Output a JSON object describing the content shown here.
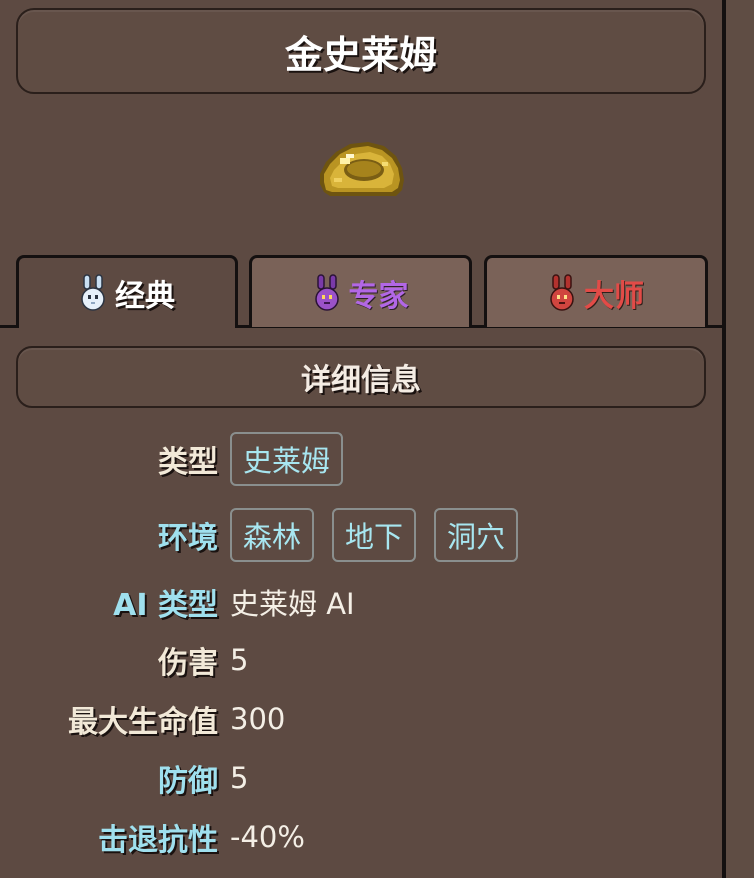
{
  "title": "金史莱姆",
  "sprite": "golden-slime-sprite",
  "tabs": [
    {
      "label": "经典",
      "icon": "bunny-classic-icon",
      "color": "#ffffff"
    },
    {
      "label": "专家",
      "icon": "bunny-expert-icon",
      "color": "#b267e6"
    },
    {
      "label": "大师",
      "icon": "bunny-master-icon",
      "color": "#e24b47"
    }
  ],
  "active_tab": "经典",
  "section_title": "详细信息",
  "details": {
    "type_label": "类型",
    "type_chips": [
      "史莱姆"
    ],
    "environment_label": "环境",
    "environment_chips": [
      "森林",
      "地下",
      "洞穴"
    ],
    "ai_type_label": "AI 类型",
    "ai_type_value": "史莱姆 AI",
    "damage_label": "伤害",
    "damage_value": "5",
    "max_life_label": "最大生命值",
    "max_life_value": "300",
    "defense_label": "防御",
    "defense_value": "5",
    "knockback_label": "击退抗性",
    "knockback_value": "-40%"
  },
  "colors": {
    "background": "#5d4a42",
    "link": "#9fe0ee",
    "expert": "#b267e6",
    "master": "#e24b47"
  }
}
